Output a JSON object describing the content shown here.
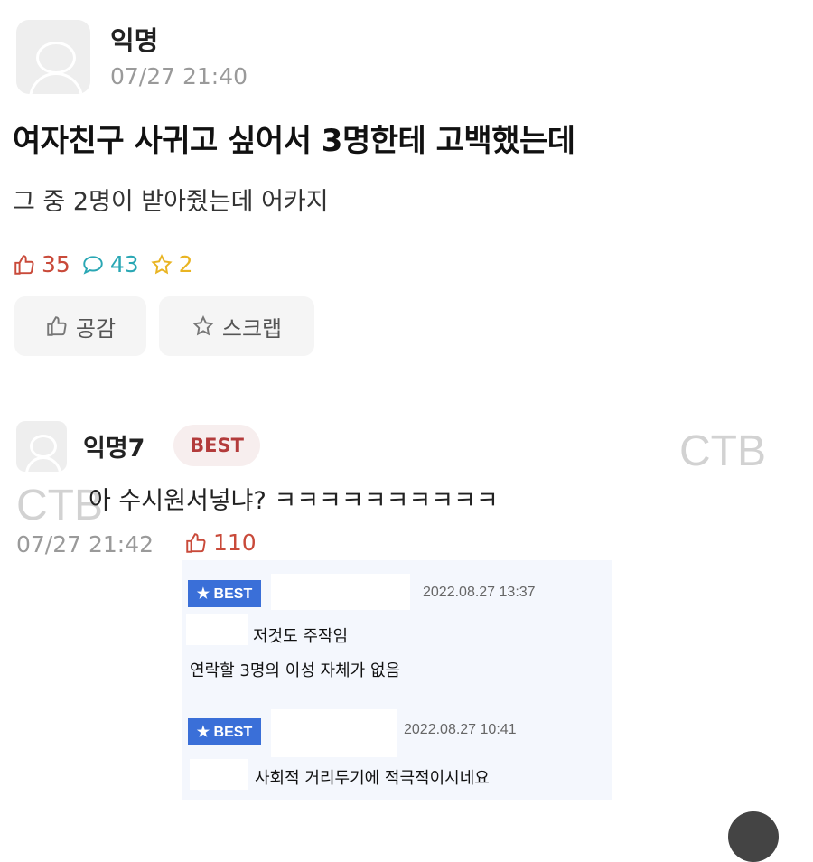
{
  "post": {
    "author": "익명",
    "time": "07/27 21:40",
    "title": "여자친구 사귀고 싶어서 3명한테 고백했는데",
    "body": "그 중 2명이 받아줬는데 어카지",
    "stats": {
      "likes": "35",
      "comments": "43",
      "scraps": "2"
    },
    "actions": {
      "like_label": "공감",
      "scrap_label": "스크랩"
    }
  },
  "comment": {
    "author": "익명7",
    "badge": "BEST",
    "text": "아 수시원서넣냐? ㅋㅋㅋㅋㅋㅋㅋㅋㅋㅋ",
    "time": "07/27 21:42",
    "likes": "110"
  },
  "watermark": "CTB",
  "replies": [
    {
      "badge": "★ BEST",
      "date": "2022.08.27 13:37",
      "lines": [
        "저것도 주작임",
        "연락할 3명의 이성 자체가 없음"
      ]
    },
    {
      "badge": "★ BEST",
      "date": "2022.08.27 10:41",
      "lines": [
        "사회적 거리두기에 적극적이시네요"
      ]
    }
  ],
  "colors": {
    "like": "#c94a3a",
    "comment": "#2aa7b4",
    "scrap": "#e9b422",
    "best_tag": "#3a6fd8",
    "best_badge_text": "#b33b3b"
  },
  "icons": [
    "avatar-icon",
    "thumbs-up-icon",
    "comment-bubble-icon",
    "star-icon"
  ]
}
